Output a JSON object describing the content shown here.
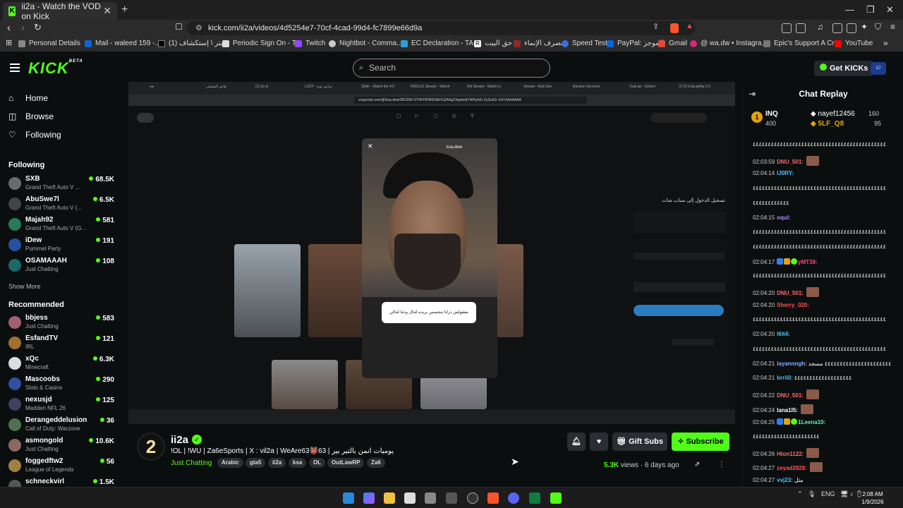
{
  "browser": {
    "tab_title": "ii2a - Watch the VOD on Kick",
    "url": "kick.com/ii2a/videos/4d5254e7-70cf-4cad-99d4-fc7899e66d9a",
    "bookmarks": [
      "Personal Details",
      "Mail - waleed 159 -...",
      "(1) تويتر \\ إستكشاف",
      "Periodic Sign On - T...",
      "Twitch",
      "Nightbot - Comma...",
      "EC Declaration - TA...",
      "حق البيت",
      "مصرف الإنماء",
      "Speed Test",
      "PayPal: الموجز",
      "Gmail",
      "@ wa.dw • Instagra...",
      "Epic's Support A Cr...",
      "YouTube"
    ]
  },
  "kick": {
    "logo": "KICK",
    "logo_sup": "BETA",
    "search_placeholder": "Search",
    "get_kicks": "Get KICKs"
  },
  "sidebar": {
    "nav": [
      "Home",
      "Browse",
      "Following"
    ],
    "following_title": "Following",
    "following": [
      {
        "name": "SXB",
        "category": "Grand Theft Auto V ...",
        "viewers": "68.5K",
        "color": "#6b6b6b"
      },
      {
        "name": "AbuSwe7l",
        "category": "Grand Theft Auto V (...",
        "viewers": "6.5K",
        "color": "#444"
      },
      {
        "name": "Majah92",
        "category": "Grand Theft Auto V (G...",
        "viewers": "581",
        "color": "#2a7a5a"
      },
      {
        "name": "iDew",
        "category": "Pummel Party",
        "viewers": "191",
        "color": "#2850a0"
      },
      {
        "name": "OSAMAAAH",
        "category": "Just Chatting",
        "viewers": "108",
        "color": "#1a6a6a"
      }
    ],
    "show_more": "Show More",
    "recommended_title": "Recommended",
    "recommended": [
      {
        "name": "bbjess",
        "category": "Just Chatting",
        "viewers": "583",
        "color": "#a06070"
      },
      {
        "name": "EsfandTV",
        "category": "IRL",
        "viewers": "121",
        "color": "#a07030"
      },
      {
        "name": "xQc",
        "category": "Minecraft",
        "viewers": "6.3K",
        "color": "#ddd"
      },
      {
        "name": "Mascoobs",
        "category": "Slots & Casino",
        "viewers": "290",
        "color": "#3050a0"
      },
      {
        "name": "nexusjd",
        "category": "Madden NFL 26",
        "viewers": "125",
        "color": "#404060"
      },
      {
        "name": "Derangeddelusion",
        "category": "Call of Duty: Warzone",
        "viewers": "36",
        "color": "#507050"
      },
      {
        "name": "asmongold",
        "category": "Just Chatting",
        "viewers": "10.6K",
        "color": "#8a6a60"
      },
      {
        "name": "foggedftw2",
        "category": "League of Legends",
        "viewers": "56",
        "color": "#a08040"
      },
      {
        "name": "schneckvirl",
        "category": "",
        "viewers": "1.5K",
        "color": "#555"
      }
    ]
  },
  "video": {
    "snap_url": "snapchat.com/@/ksa.dew/28V2N0-OT0KPIDR0OfpFEQAAgZ3pybmljYWFpAZr-Zy3uAZr-2cFGAAAAAA",
    "story_text": "معقولش دراتا يتحسس بريده لحال وحنا لحالن",
    "story_user": "ksa.dew",
    "snap_login": "تسجيل الدخول إلى سناب شات"
  },
  "channel": {
    "name": "ii2a",
    "title": "!OL | !WU | Za6eSports | X : vil2a | WeAre63👹63 | يوميات انمن بالتير بير",
    "category": "Just Chatting",
    "tags": [
      "Arabic",
      "gta5",
      "ii2a",
      "ksa",
      "OL",
      "OutLawRP",
      "Za6"
    ],
    "views": "5.3K",
    "views_label": "views",
    "age": "6 days ago",
    "gift_subs": "Gift Subs",
    "subscribe": "Subscribe"
  },
  "chat": {
    "title": "Chat Replay",
    "pinned": [
      {
        "rank": "1",
        "name": "INQ",
        "amount": "400"
      },
      {
        "name": "nayef12456",
        "amount": "160"
      },
      {
        "name": "5LF_Q8",
        "amount": "95"
      }
    ],
    "messages": [
      {
        "time": "",
        "user": "",
        "text": "٤٤٤٤٤٤٤٤٤٤٤٤٤٤٤٤٤٤٤٤٤٤٤٤٤٤٤٤٤٤٤٤٤٤٤٤٤٤٤٤٤٤٤٤",
        "color": "#fff"
      },
      {
        "time": "02:03:59",
        "user": "DNU_501:",
        "text": "",
        "color": "#ff6b6b",
        "emote": true
      },
      {
        "time": "02:04:14",
        "user": "IJ0RY:",
        "text": "",
        "color": "#4fc3f7"
      },
      {
        "time": "",
        "user": "",
        "text": "٤٤٤٤٤٤٤٤٤٤٤٤٤٤٤٤٤٤٤٤٤٤٤٤٤٤٤٤٤٤٤٤٤٤٤٤٤٤٤٤٤٤٤٤",
        "color": "#fff"
      },
      {
        "time": "",
        "user": "",
        "text": "٤٤٤٤٤٤٤٤٤٤٤٤",
        "color": "#fff"
      },
      {
        "time": "02:04:15",
        "user": "oqul:",
        "text": "",
        "color": "#b388ff"
      },
      {
        "time": "",
        "user": "",
        "text": "٤٤٤٤٤٤٤٤٤٤٤٤٤٤٤٤٤٤٤٤٤٤٤٤٤٤٤٤٤٤٤٤٤٤٤٤٤٤٤٤٤٤٤٤",
        "color": "#fff"
      },
      {
        "time": "",
        "user": "",
        "text": "٤٤٤٤٤٤٤٤٤٤٤٤٤٤٤٤٤٤٤٤٤٤٤٤٤٤٤٤٤٤٤٤٤٤٤٤٤٤٤٤٤٤٤٤",
        "color": "#fff"
      },
      {
        "time": "02:04:17",
        "user": "yMT38:",
        "text": "",
        "color": "#ff4081",
        "badges": true
      },
      {
        "time": "",
        "user": "",
        "text": "٤٤٤٤٤٤٤٤٤٤٤٤٤٤٤٤٤٤٤٤٤٤٤٤٤٤٤٤٤٤٤٤٤٤٤٤٤٤٤٤٤٤٤٤",
        "color": "#fff"
      },
      {
        "time": "02:04:20",
        "user": "DNU_501:",
        "text": "",
        "color": "#ff6b6b",
        "emote": true
      },
      {
        "time": "02:04:20",
        "user": "Sherry_020:",
        "text": "",
        "color": "#ff5252"
      },
      {
        "time": "",
        "user": "",
        "text": "٤٤٤٤٤٤٤٤٤٤٤٤٤٤٤٤٤٤٤٤٤٤٤٤٤٤٤٤٤٤٤٤٤٤٤٤٤٤٤٤٤٤٤٤",
        "color": "#fff"
      },
      {
        "time": "02:04:20",
        "user": "l6lt4:",
        "text": "",
        "color": "#4fc3f7"
      },
      {
        "time": "",
        "user": "",
        "text": "٤٤٤٤٤٤٤٤٤٤٤٤٤٤٤٤٤٤٤٤٤٤٤٤٤٤٤٤٤٤٤٤٤٤٤٤٤٤٤٤٤٤٤٤",
        "color": "#fff"
      },
      {
        "time": "02:04:21",
        "user": "layannngh:",
        "text": "٤٤٤٤٤٤٤٤٤٤٤٤٤٤٤٤٤٤٤٤٤٤ مسجد",
        "color": "#82b1ff"
      },
      {
        "time": "02:04:21",
        "user": "brrii0:",
        "text": "٤٤٤٤٤٤٤٤٤٤٤٤٤٤٤٤٤٤٤",
        "color": "#4fc3f7"
      },
      {
        "time": "02:04:22",
        "user": "DNU_501:",
        "text": "",
        "color": "#ff6b6b",
        "emote": true
      },
      {
        "time": "02:04:24",
        "user": "lana1l5:",
        "text": "",
        "color": "#fff",
        "emote": true
      },
      {
        "time": "02:04:25",
        "user": "1Leena10:",
        "text": "",
        "color": "#69f0ae",
        "badges": true
      },
      {
        "time": "",
        "user": "",
        "text": "٤٤٤٤٤٤٤٤٤٤٤٤٤٤٤٤٤٤٤٤٤٤",
        "color": "#fff"
      },
      {
        "time": "02:04:26",
        "user": "Hton1122:",
        "text": "",
        "color": "#ff6b6b",
        "emote": true
      },
      {
        "time": "02:04:27",
        "user": "zeyad2828:",
        "text": "",
        "color": "#ff5252",
        "emote": true
      },
      {
        "time": "02:04:27",
        "user": "vvj23:",
        "text": "مثل",
        "color": "#4fc3f7"
      }
    ]
  },
  "taskbar": {
    "lang": "ENG",
    "time": "2:08 AM",
    "date": "1/9/2026"
  }
}
